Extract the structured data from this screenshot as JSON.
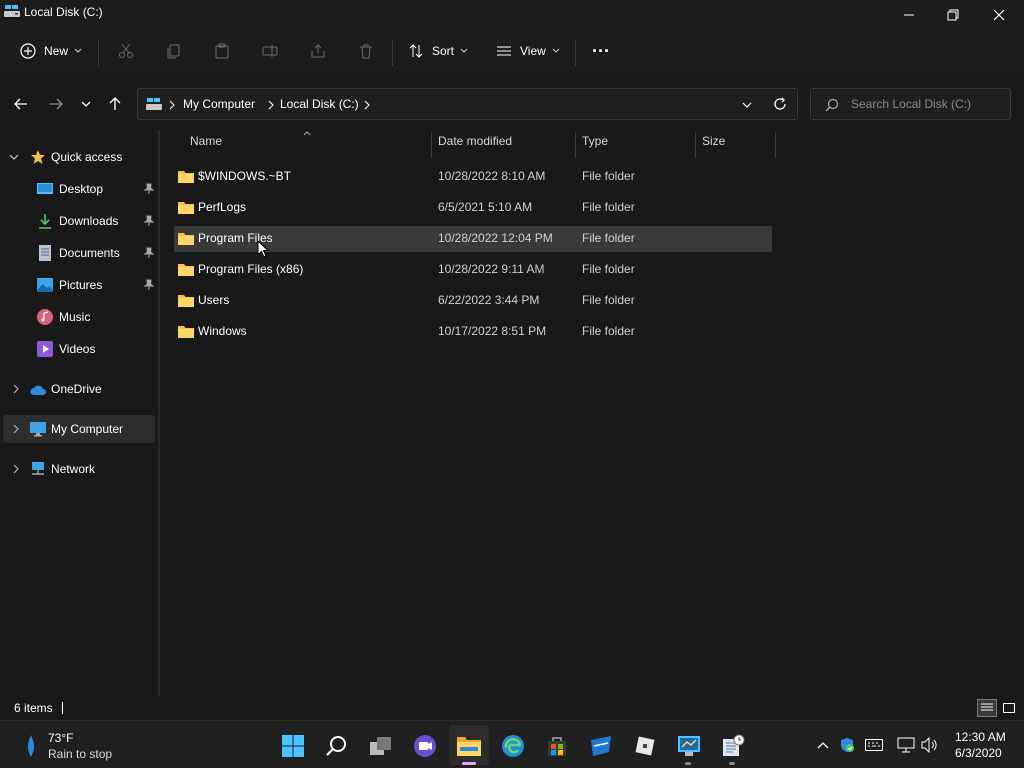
{
  "window": {
    "title": "Local Disk (C:)"
  },
  "command_bar": {
    "new_label": "New",
    "sort_label": "Sort",
    "view_label": "View",
    "more_label": "···"
  },
  "address": {
    "breadcrumbs": [
      "My Computer",
      "Local Disk (C:)"
    ],
    "search_placeholder": "Search Local Disk (C:)"
  },
  "sidebar": {
    "quick_access": "Quick access",
    "items": [
      {
        "label": "Desktop",
        "icon": "desktop-icon",
        "pinned": true
      },
      {
        "label": "Downloads",
        "icon": "downloads-icon",
        "pinned": true
      },
      {
        "label": "Documents",
        "icon": "documents-icon",
        "pinned": true
      },
      {
        "label": "Pictures",
        "icon": "pictures-icon",
        "pinned": true
      },
      {
        "label": "Music",
        "icon": "music-icon",
        "pinned": false
      },
      {
        "label": "Videos",
        "icon": "videos-icon",
        "pinned": false
      }
    ],
    "onedrive": "OneDrive",
    "my_computer": "My Computer",
    "network": "Network"
  },
  "files": {
    "columns": {
      "name": "Name",
      "date": "Date modified",
      "type": "Type",
      "size": "Size"
    },
    "rows": [
      {
        "name": "$WINDOWS.~BT",
        "date": "10/28/2022 8:10 AM",
        "type": "File folder",
        "size": ""
      },
      {
        "name": "PerfLogs",
        "date": "6/5/2021 5:10 AM",
        "type": "File folder",
        "size": ""
      },
      {
        "name": "Program Files",
        "date": "10/28/2022 12:04 PM",
        "type": "File folder",
        "size": "",
        "selected": true
      },
      {
        "name": "Program Files (x86)",
        "date": "10/28/2022 9:11 AM",
        "type": "File folder",
        "size": ""
      },
      {
        "name": "Users",
        "date": "6/22/2022 3:44 PM",
        "type": "File folder",
        "size": ""
      },
      {
        "name": "Windows",
        "date": "10/17/2022 8:51 PM",
        "type": "File folder",
        "size": ""
      }
    ]
  },
  "status": {
    "items_count": "6 items"
  },
  "taskbar": {
    "weather_temp": "73°F",
    "weather_desc": "Rain to stop",
    "clock_time": "12:30 AM",
    "clock_date": "6/3/2020"
  },
  "colors": {
    "folder": "#f4c34a",
    "accent": "#4cc2ff",
    "selected_row": "#3a3a3a"
  }
}
